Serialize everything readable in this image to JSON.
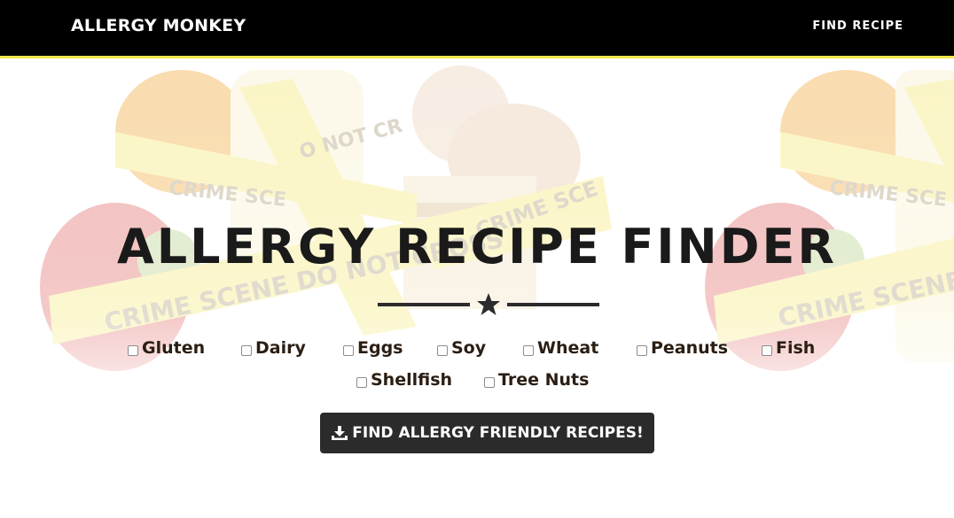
{
  "navbar": {
    "brand": "ALLERGY MONKEY",
    "link_label": "FIND RECIPE"
  },
  "hero": {
    "title": "ALLERGY RECIPE FINDER",
    "divider_icon": "star-icon",
    "allergens": [
      {
        "label": "Gluten",
        "checked": false
      },
      {
        "label": "Dairy",
        "checked": false
      },
      {
        "label": "Eggs",
        "checked": false
      },
      {
        "label": "Soy",
        "checked": false
      },
      {
        "label": "Wheat",
        "checked": false
      },
      {
        "label": "Peanuts",
        "checked": false
      },
      {
        "label": "Fish",
        "checked": false
      },
      {
        "label": "Shellfish",
        "checked": false
      },
      {
        "label": "Tree Nuts",
        "checked": false
      }
    ],
    "button": {
      "icon": "download-icon",
      "label": "FIND ALLERGY FRIENDLY RECIPES!"
    }
  },
  "colors": {
    "navbar_bg": "#000000",
    "navbar_accent": "#f2e74a",
    "button_bg": "#2b2b2b",
    "title_text": "#1a1a1a"
  }
}
